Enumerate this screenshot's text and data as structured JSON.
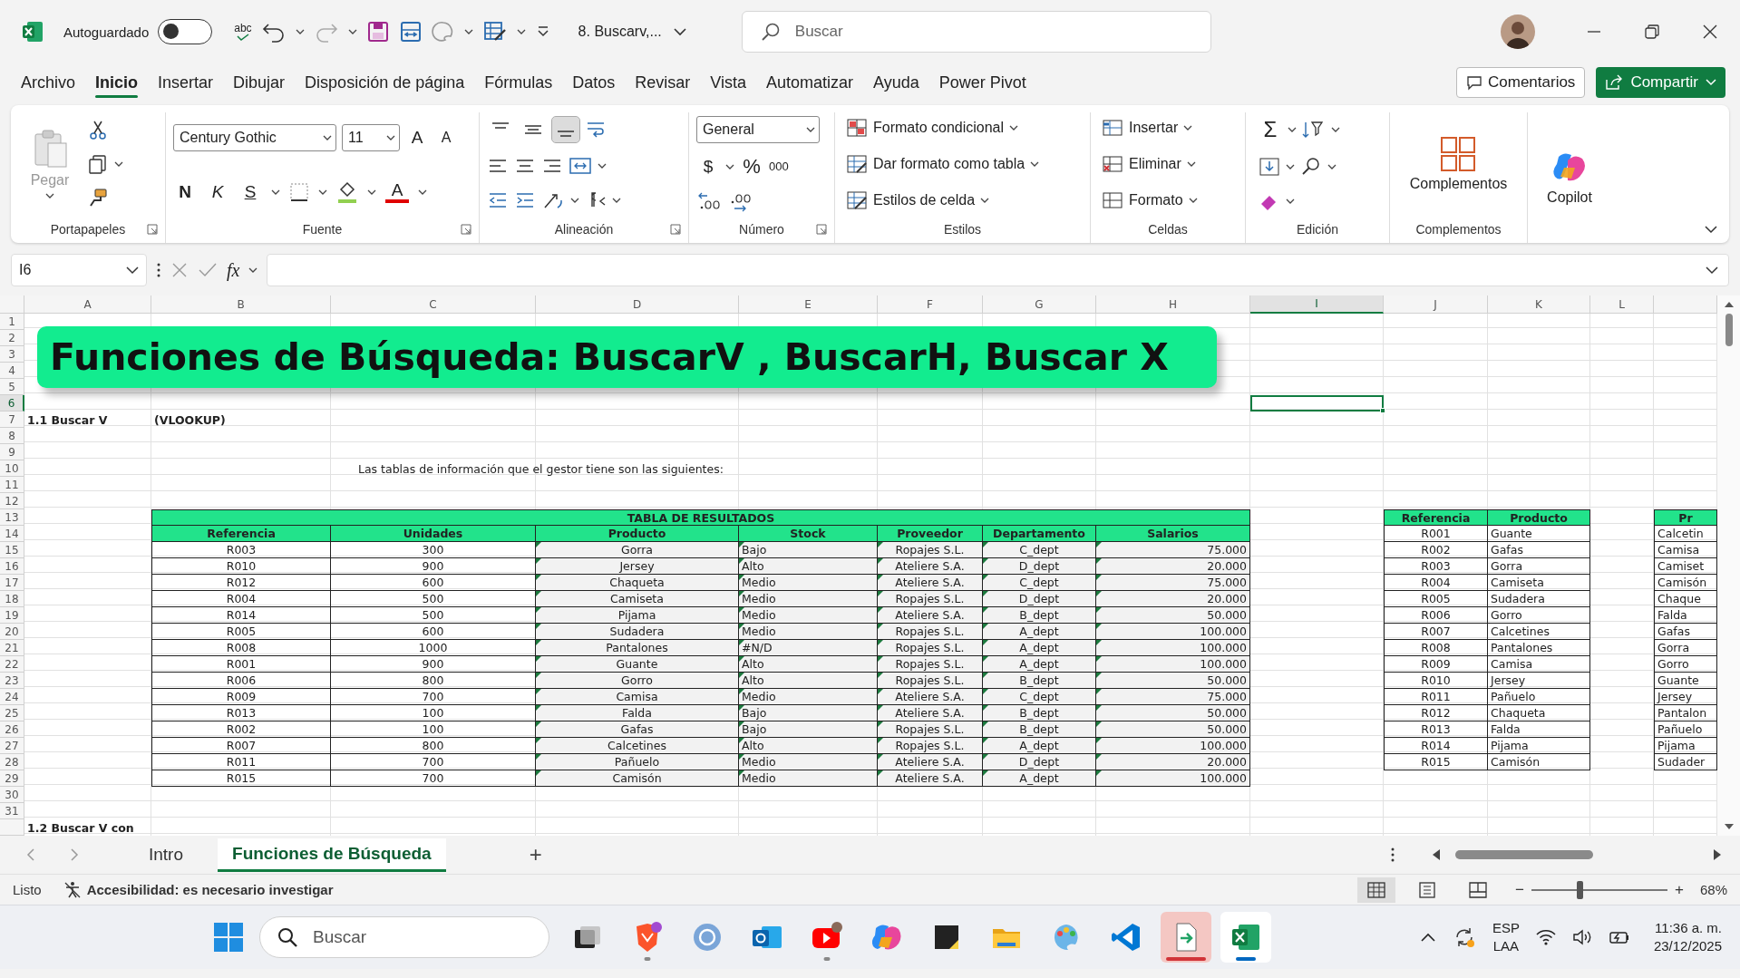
{
  "title_bar": {
    "autosave_label": "Autoguardado",
    "autosave_on": false,
    "spell_label": "abc",
    "file_name": "8. Buscarv,...",
    "search_placeholder": "Buscar"
  },
  "menu_tabs": [
    {
      "label": "Archivo",
      "selected": false
    },
    {
      "label": "Inicio",
      "selected": true
    },
    {
      "label": "Insertar",
      "selected": false
    },
    {
      "label": "Dibujar",
      "selected": false
    },
    {
      "label": "Disposición de página",
      "selected": false
    },
    {
      "label": "Fórmulas",
      "selected": false
    },
    {
      "label": "Datos",
      "selected": false
    },
    {
      "label": "Revisar",
      "selected": false
    },
    {
      "label": "Vista",
      "selected": false
    },
    {
      "label": "Automatizar",
      "selected": false
    },
    {
      "label": "Ayuda",
      "selected": false
    },
    {
      "label": "Power Pivot",
      "selected": false
    }
  ],
  "comments_button": "Comentarios",
  "share_button": "Compartir",
  "ribbon": {
    "clipboard": {
      "label": "Portapapeles",
      "paste": "Pegar",
      "paste_disabled": true
    },
    "font": {
      "label": "Fuente",
      "font_name": "Century Gothic",
      "font_size": "11",
      "grow": "A",
      "shrink": "A",
      "bold": "N",
      "italic": "K",
      "underline": "S",
      "font_color": "A"
    },
    "alignment": {
      "label": "Alineación",
      "vertical_buttons": [
        {
          "selected": false
        },
        {
          "selected": false
        },
        {
          "selected": true
        }
      ]
    },
    "number": {
      "label": "Número",
      "format": "General",
      "currency": "$",
      "percent": "%",
      "thousands": "000"
    },
    "styles": {
      "label": "Estilos",
      "buttons": [
        "Formato condicional",
        "Dar formato como tabla",
        "Estilos de celda"
      ]
    },
    "cells": {
      "label": "Celdas",
      "buttons": [
        "Insertar",
        "Eliminar",
        "Formato"
      ]
    },
    "editing": {
      "label": "Edición",
      "sum": "Σ"
    },
    "addins": {
      "label": "Complementos",
      "button": "Complementos"
    },
    "copilot": {
      "button": "Copilot"
    }
  },
  "formula_bar": {
    "name_box": "I6",
    "fx": "fx"
  },
  "sheet": {
    "column_letters": [
      {
        "label": "A",
        "selected": false
      },
      {
        "label": "B",
        "selected": false
      },
      {
        "label": "C",
        "selected": false
      },
      {
        "label": "D",
        "selected": false
      },
      {
        "label": "E",
        "selected": false
      },
      {
        "label": "F",
        "selected": false
      },
      {
        "label": "G",
        "selected": false
      },
      {
        "label": "H",
        "selected": false
      },
      {
        "label": "I",
        "selected": true
      },
      {
        "label": "J",
        "selected": false
      },
      {
        "label": "K",
        "selected": false
      },
      {
        "label": "L",
        "selected": false
      }
    ],
    "row_numbers": [
      {
        "label": "1",
        "selected": false
      },
      {
        "label": "2",
        "selected": false
      },
      {
        "label": "3",
        "selected": false
      },
      {
        "label": "4",
        "selected": false
      },
      {
        "label": "5",
        "selected": false
      },
      {
        "label": "6",
        "selected": true
      },
      {
        "label": "7",
        "selected": false
      },
      {
        "label": "8",
        "selected": false
      },
      {
        "label": "9",
        "selected": false
      },
      {
        "label": "10",
        "selected": false
      },
      {
        "label": "11",
        "selected": false
      },
      {
        "label": "12",
        "selected": false
      },
      {
        "label": "13",
        "selected": false
      },
      {
        "label": "14",
        "selected": false
      },
      {
        "label": "15",
        "selected": false
      },
      {
        "label": "16",
        "selected": false
      },
      {
        "label": "17",
        "selected": false
      },
      {
        "label": "18",
        "selected": false
      },
      {
        "label": "19",
        "selected": false
      },
      {
        "label": "20",
        "selected": false
      },
      {
        "label": "21",
        "selected": false
      },
      {
        "label": "22",
        "selected": false
      },
      {
        "label": "23",
        "selected": false
      },
      {
        "label": "24",
        "selected": false
      },
      {
        "label": "25",
        "selected": false
      },
      {
        "label": "26",
        "selected": false
      },
      {
        "label": "27",
        "selected": false
      },
      {
        "label": "28",
        "selected": false
      },
      {
        "label": "29",
        "selected": false
      },
      {
        "label": "30",
        "selected": false
      },
      {
        "label": "31",
        "selected": false
      }
    ],
    "banner": "Funciones de Búsqueda: BuscarV , BuscarH, Buscar X",
    "notes": [
      {
        "text": "1.1 Buscar V",
        "bold": true
      },
      {
        "text": "(VLOOKUP)",
        "bold": true
      },
      {
        "text": "Las tablas de información que el gestor tiene son las siguientes:",
        "bold": false
      },
      {
        "text": "1.2 Buscar V con",
        "bold": true
      }
    ],
    "results_table": {
      "title": "TABLA DE RESULTADOS",
      "columns": [
        {
          "label": "Referencia",
          "flagged": false
        },
        {
          "label": "Unidades",
          "flagged": false
        },
        {
          "label": "Producto",
          "flagged": true
        },
        {
          "label": "Stock",
          "flagged": true
        },
        {
          "label": "Proveedor",
          "flagged": true
        },
        {
          "label": "Departamento",
          "flagged": true
        },
        {
          "label": "Salarios",
          "flagged": true
        }
      ],
      "rows": [
        [
          "R003",
          "300",
          "Gorra",
          "Bajo",
          "Ropajes S.L.",
          "C_dept",
          "75.000"
        ],
        [
          "R010",
          "900",
          "Jersey",
          "Alto",
          "Ateliere S.A.",
          "D_dept",
          "20.000"
        ],
        [
          "R012",
          "600",
          "Chaqueta",
          "Medio",
          "Ateliere S.A.",
          "C_dept",
          "75.000"
        ],
        [
          "R004",
          "500",
          "Camiseta",
          "Medio",
          "Ropajes S.L.",
          "D_dept",
          "20.000"
        ],
        [
          "R014",
          "500",
          "Pijama",
          "Medio",
          "Ateliere S.A.",
          "B_dept",
          "50.000"
        ],
        [
          "R005",
          "600",
          "Sudadera",
          "Medio",
          "Ropajes S.L.",
          "A_dept",
          "100.000"
        ],
        [
          "R008",
          "1000",
          "Pantalones",
          "#N/D",
          "Ropajes S.L.",
          "A_dept",
          "100.000"
        ],
        [
          "R001",
          "900",
          "Guante",
          "Alto",
          "Ropajes S.L.",
          "A_dept",
          "100.000"
        ],
        [
          "R006",
          "800",
          "Gorro",
          "Alto",
          "Ropajes S.L.",
          "B_dept",
          "50.000"
        ],
        [
          "R009",
          "700",
          "Camisa",
          "Medio",
          "Ateliere S.A.",
          "C_dept",
          "75.000"
        ],
        [
          "R013",
          "100",
          "Falda",
          "Bajo",
          "Ateliere S.A.",
          "B_dept",
          "50.000"
        ],
        [
          "R002",
          "100",
          "Gafas",
          "Bajo",
          "Ropajes S.L.",
          "B_dept",
          "50.000"
        ],
        [
          "R007",
          "800",
          "Calcetines",
          "Alto",
          "Ropajes S.L.",
          "A_dept",
          "100.000"
        ],
        [
          "R011",
          "700",
          "Pañuelo",
          "Medio",
          "Ateliere S.A.",
          "D_dept",
          "20.000"
        ],
        [
          "R015",
          "700",
          "Camisón",
          "Medio",
          "Ateliere S.A.",
          "A_dept",
          "100.000"
        ]
      ]
    },
    "lookup_table": {
      "columns": [
        "Referencia",
        "Producto"
      ],
      "rows": [
        [
          "R001",
          "Guante"
        ],
        [
          "R002",
          "Gafas"
        ],
        [
          "R003",
          "Gorra"
        ],
        [
          "R004",
          "Camiseta"
        ],
        [
          "R005",
          "Sudadera"
        ],
        [
          "R006",
          "Gorro"
        ],
        [
          "R007",
          "Calcetines"
        ],
        [
          "R008",
          "Pantalones"
        ],
        [
          "R009",
          "Camisa"
        ],
        [
          "R010",
          "Jersey"
        ],
        [
          "R011",
          "Pañuelo"
        ],
        [
          "R012",
          "Chaqueta"
        ],
        [
          "R013",
          "Falda"
        ],
        [
          "R014",
          "Pijama"
        ],
        [
          "R015",
          "Camisón"
        ]
      ]
    },
    "partial_table": {
      "columns": [
        "Pr"
      ],
      "rows": [
        [
          "Calcetin"
        ],
        [
          "Camisa"
        ],
        [
          "Camiset"
        ],
        [
          "Camisón"
        ],
        [
          "Chaque"
        ],
        [
          "Falda"
        ],
        [
          "Gafas"
        ],
        [
          "Gorra"
        ],
        [
          "Gorro"
        ],
        [
          "Guante"
        ],
        [
          "Jersey"
        ],
        [
          "Pantalon"
        ],
        [
          "Pañuelo"
        ],
        [
          "Pijama"
        ],
        [
          "Sudader"
        ]
      ]
    }
  },
  "sheet_tabs": [
    {
      "label": "Intro",
      "selected": false
    },
    {
      "label": "Funciones de Búsqueda",
      "selected": true
    }
  ],
  "add_sheet": "+",
  "status_bar": {
    "ready": "Listo",
    "accessibility": "Accesibilidad: es necesario investigar",
    "views": [
      {
        "selected": true
      },
      {
        "selected": false
      },
      {
        "selected": false
      }
    ],
    "zoom_minus": "−",
    "zoom_plus": "+",
    "zoom": {
      "level": 0.35
    },
    "zoom_label": "68%"
  },
  "taskbar": {
    "search_placeholder": "Buscar",
    "apps": [
      {
        "running": false,
        "open": false
      },
      {
        "running": true,
        "open": false
      },
      {
        "running": false,
        "open": false
      },
      {
        "running": false,
        "open": false
      },
      {
        "running": true,
        "open": false
      },
      {
        "running": false,
        "open": false
      },
      {
        "running": false,
        "open": false
      },
      {
        "running": false,
        "open": false
      },
      {
        "running": false,
        "open": false
      },
      {
        "running": false,
        "open": false
      },
      {
        "running": false,
        "open": true,
        "color": "#d13438"
      },
      {
        "running": false,
        "open": true,
        "color": "#0067c0"
      }
    ],
    "language": "ESP",
    "layout": "LAA",
    "time": "11:36 a. m.",
    "date": "23/12/2025"
  }
}
